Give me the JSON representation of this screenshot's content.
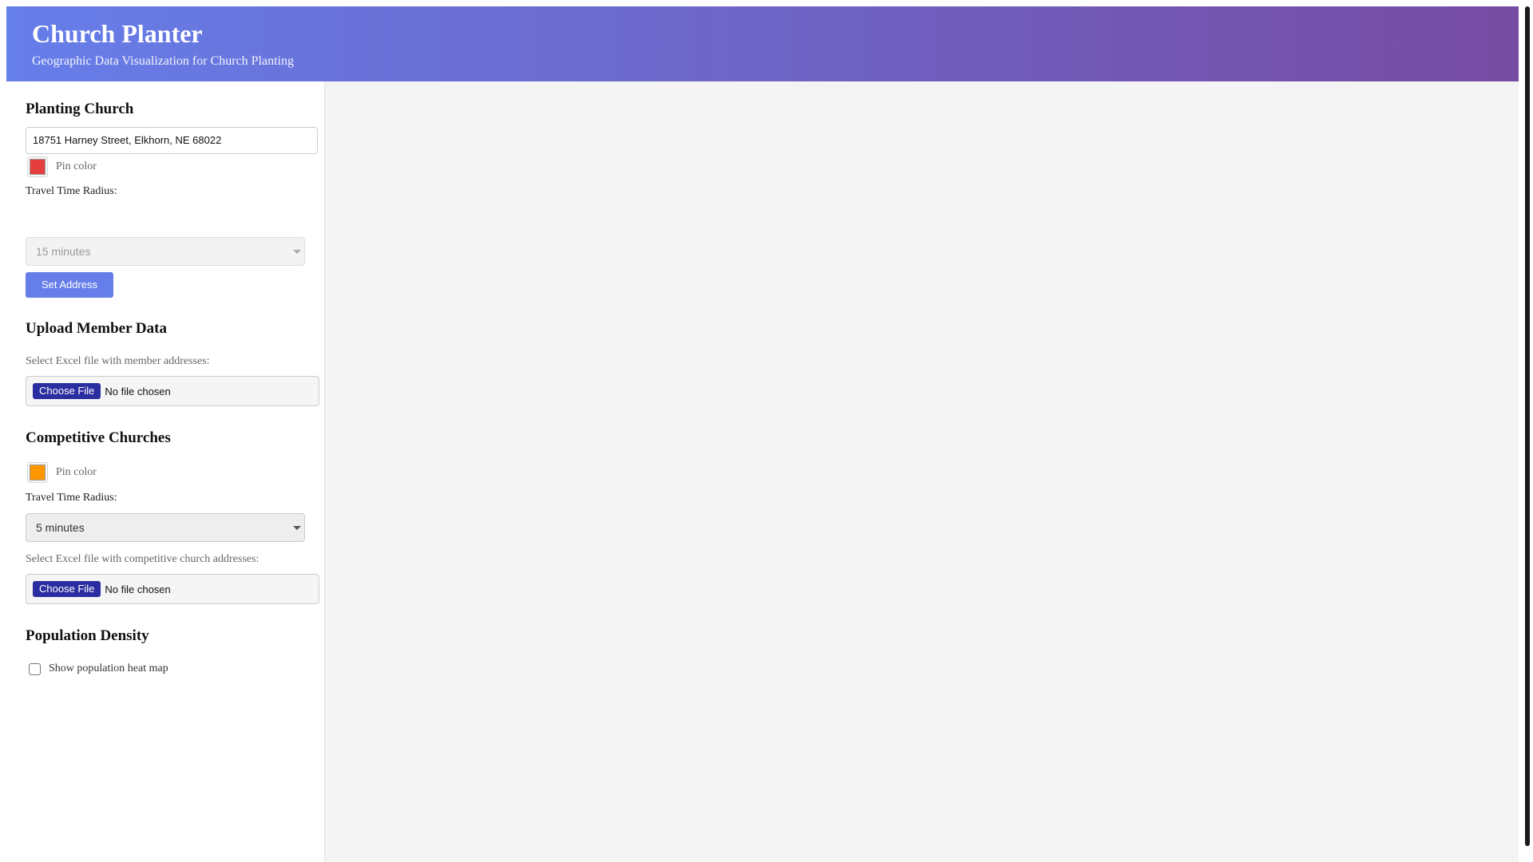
{
  "header": {
    "title": "Church Planter",
    "subtitle": "Geographic Data Visualization for Church Planting"
  },
  "planting_church": {
    "title": "Planting Church",
    "address_value": "18751 Harney Street, Elkhorn, NE 68022",
    "pin_color_label": "Pin color",
    "pin_color": "#e53e3e",
    "radius_label": "Travel Time Radius:",
    "radius_value": "15 minutes",
    "radius_disabled": true,
    "set_address_label": "Set Address"
  },
  "member_data": {
    "title": "Upload Member Data",
    "file_label": "Select Excel file with member addresses:",
    "choose_file_label": "Choose File",
    "file_status": "No file chosen"
  },
  "competitive": {
    "title": "Competitive Churches",
    "pin_color_label": "Pin color",
    "pin_color": "#ff9800",
    "radius_label": "Travel Time Radius:",
    "radius_value": "5 minutes",
    "file_label": "Select Excel file with competitive church addresses:",
    "choose_file_label": "Choose File",
    "file_status": "No file chosen"
  },
  "population": {
    "title": "Population Density",
    "heatmap_label": "Show population heat map",
    "heatmap_checked": false
  },
  "colors": {
    "header_gradient_start": "#667eea",
    "header_gradient_end": "#764ba2",
    "button": "#667eea",
    "file_button": "#2b2ea0",
    "map_background": "#f4f4f4"
  }
}
